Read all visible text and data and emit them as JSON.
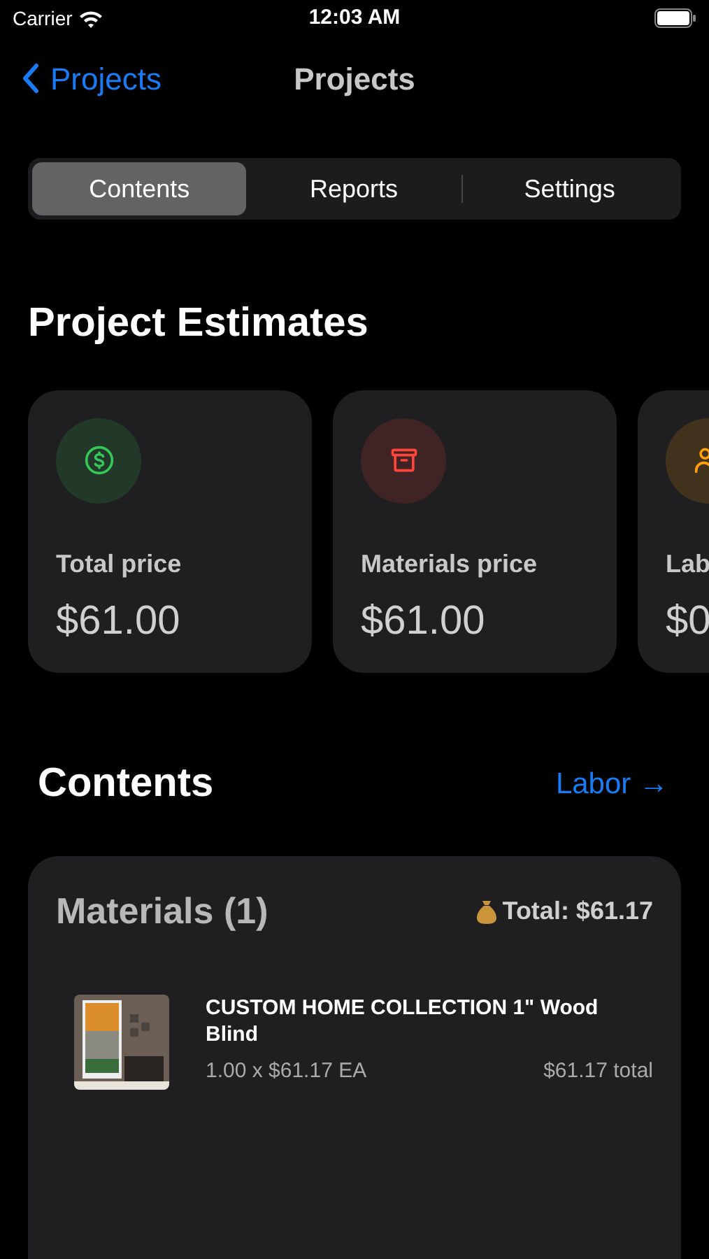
{
  "status_bar": {
    "carrier": "Carrier",
    "time": "12:03 AM"
  },
  "nav": {
    "back": "Projects",
    "title": "Projects"
  },
  "tabs": [
    {
      "label": "Contents",
      "selected": true
    },
    {
      "label": "Reports",
      "selected": false
    },
    {
      "label": "Settings",
      "selected": false
    }
  ],
  "estimates": {
    "title": "Project Estimates",
    "cards": [
      {
        "kind": "money",
        "color": "#34c759",
        "label": "Total price",
        "value": "$61.00"
      },
      {
        "kind": "box",
        "color": "#ff453a",
        "label": "Materials price",
        "value": "$61.00"
      },
      {
        "kind": "people",
        "color": "#ff9f0a",
        "label": "Lab",
        "value": "$0"
      }
    ]
  },
  "contents": {
    "title": "Contents",
    "link": "Labor →",
    "materials": {
      "title": "Materials (1)",
      "total": "Total: $61.17",
      "items": [
        {
          "kind": "picture",
          "name": "CUSTOM HOME COLLECTION 1\" Wood Blind",
          "quantity": "1.00 x $61.17 EA",
          "total": "$61.17 total"
        }
      ]
    }
  }
}
